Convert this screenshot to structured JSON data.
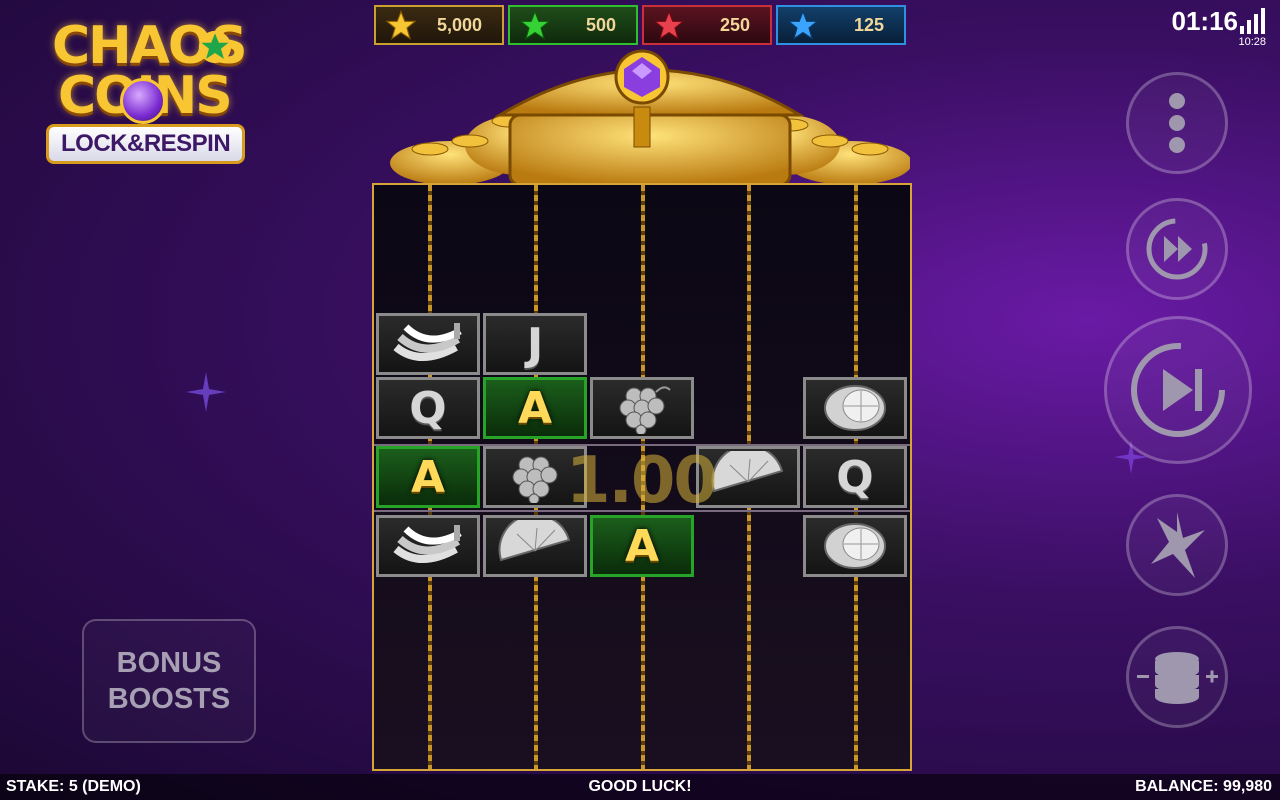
{
  "logo": {
    "line1": "CHAOS",
    "line2": "COINS",
    "tagline": "LOCK&RESPIN"
  },
  "jackpots": [
    {
      "value": "5,000",
      "color": "#f7c632",
      "icon": "gold-star-icon"
    },
    {
      "value": "500",
      "color": "#35d135",
      "icon": "green-star-icon"
    },
    {
      "value": "250",
      "color": "#e8404d",
      "icon": "red-star-icon"
    },
    {
      "value": "125",
      "color": "#3aa4ff",
      "icon": "blue-star-icon"
    }
  ],
  "status_bar": {
    "time": "01:16",
    "time_small": "10:28"
  },
  "reels": {
    "symbols": [
      {
        "id": "r1c1",
        "symbol": "banana",
        "icon": "banana-icon"
      },
      {
        "id": "r1c2",
        "symbol": "J"
      },
      {
        "id": "r2c1",
        "symbol": "Q"
      },
      {
        "id": "r2c2",
        "symbol": "A",
        "highlight": true
      },
      {
        "id": "r2c3",
        "symbol": "grapes",
        "icon": "grapes-icon"
      },
      {
        "id": "r2c5",
        "symbol": "lemon",
        "icon": "lemon-icon"
      },
      {
        "id": "r3c1",
        "symbol": "A",
        "highlight": true
      },
      {
        "id": "r3c2",
        "symbol": "grapes",
        "icon": "grapes-icon"
      },
      {
        "id": "r3c4",
        "symbol": "orange",
        "icon": "orange-slice-icon"
      },
      {
        "id": "r3c5",
        "symbol": "Q"
      },
      {
        "id": "r4c1",
        "symbol": "banana",
        "icon": "banana-icon"
      },
      {
        "id": "r4c2",
        "symbol": "orange",
        "icon": "orange-slice-icon"
      },
      {
        "id": "r4c3",
        "symbol": "A",
        "highlight": true
      },
      {
        "id": "r4c5",
        "symbol": "lemon",
        "icon": "lemon-icon"
      }
    ],
    "win_amount": "1.00"
  },
  "controls": {
    "menu_icon": "more-vertical-icon",
    "turbo_icon": "fast-forward-icon",
    "spin_icon": "spin-play-icon",
    "autoplay_icon": "lightning-icon",
    "stake_icon": "coin-stack-icon"
  },
  "bonus": {
    "line1": "BONUS",
    "line2": "BOOSTS"
  },
  "footer": {
    "stake": "STAKE: 5 (DEMO)",
    "message": "GOOD LUCK!",
    "balance": "BALANCE: 99,980"
  }
}
